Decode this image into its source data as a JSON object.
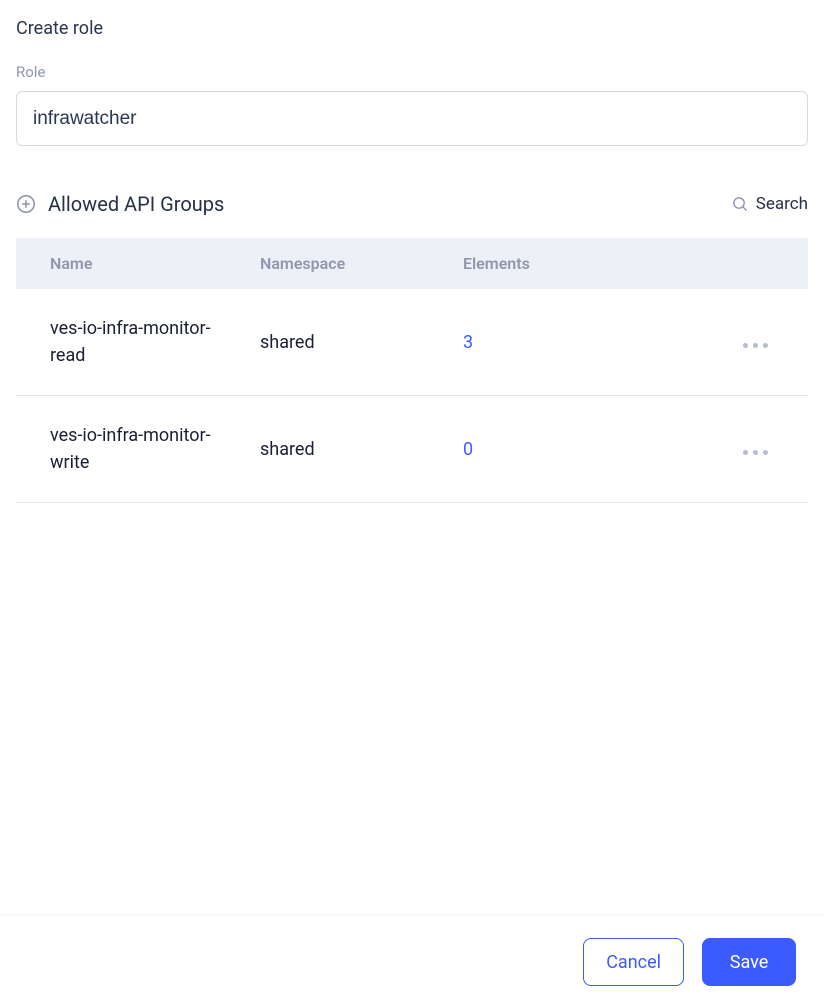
{
  "page_title": "Create role",
  "role_field": {
    "label": "Role",
    "value": "infrawatcher"
  },
  "api_groups": {
    "section_title": "Allowed API Groups",
    "search_label": "Search",
    "columns": {
      "name": "Name",
      "namespace": "Namespace",
      "elements": "Elements"
    },
    "rows": [
      {
        "name": "ves-io-infra-monitor-read",
        "namespace": "shared",
        "elements": "3"
      },
      {
        "name": "ves-io-infra-monitor-write",
        "namespace": "shared",
        "elements": "0"
      }
    ]
  },
  "footer": {
    "cancel": "Cancel",
    "save": "Save"
  }
}
